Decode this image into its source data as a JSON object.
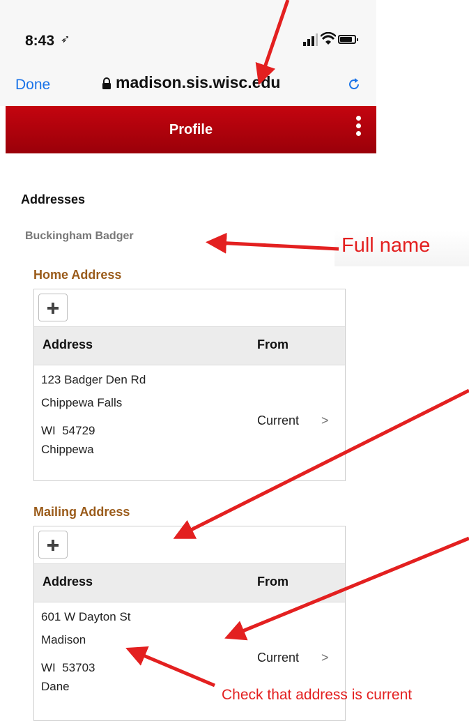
{
  "status_bar": {
    "time": "8:43",
    "location_icon": "location-arrow-icon",
    "signal_icon": "signal-icon",
    "wifi_icon": "wifi-icon",
    "battery_icon": "battery-icon"
  },
  "browser": {
    "done_label": "Done",
    "url": "madison.sis.wisc.edu",
    "lock_icon": "lock-icon",
    "reload_icon": "reload-icon"
  },
  "header": {
    "title": "Profile",
    "menu_icon": "kebab-menu-icon",
    "bar_color": "#b00010"
  },
  "page": {
    "heading": "Addresses",
    "full_name": "Buckingham Badger",
    "sections": [
      {
        "label": "Home Address",
        "columns": [
          "Address",
          "From"
        ],
        "rows": [
          {
            "lines": [
              "123 Badger Den Rd",
              "Chippewa Falls",
              "WI  54729",
              "Chippewa"
            ],
            "status": "Current"
          }
        ]
      },
      {
        "label": "Mailing Address",
        "columns": [
          "Address",
          "From"
        ],
        "rows": [
          {
            "lines": [
              "601 W Dayton St",
              "Madison",
              "WI  53703",
              "Dane"
            ],
            "status": "Current"
          }
        ]
      }
    ]
  },
  "annotations": {
    "full_name_note": "Full name",
    "current_note": "Check that address is current",
    "color": "#e32020"
  }
}
